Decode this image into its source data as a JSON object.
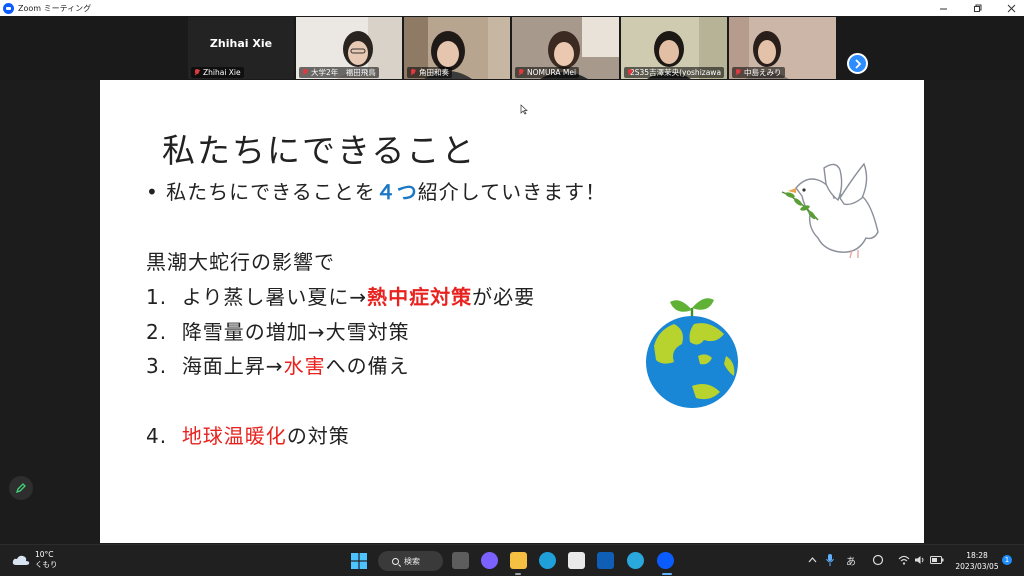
{
  "window": {
    "title": "Zoom ミーティング"
  },
  "participants": [
    {
      "name": "Zhihai Xie",
      "video": false
    },
    {
      "name": "大学2年　福田飛鳥",
      "video": true
    },
    {
      "name": "角田和奏",
      "video": true
    },
    {
      "name": "NOMURA Mei",
      "video": true
    },
    {
      "name": "2S35吉澤茉央(yoshizawa ...",
      "video": true
    },
    {
      "name": "中島えみり",
      "video": true
    }
  ],
  "slide": {
    "title": "私たちにできること",
    "bullet": {
      "pre": "私たちにできることを",
      "highlight": "４つ",
      "post": "紹介していきます！"
    },
    "intro": "黒潮大蛇行の影響で",
    "items": [
      {
        "num": "1.",
        "pre": "より蒸し暑い夏に→",
        "highlight": "熱中症対策",
        "post": "が必要",
        "bold": true
      },
      {
        "num": "2.",
        "pre": "降雪量の増加→大雪対策",
        "highlight": "",
        "post": "",
        "bold": false
      },
      {
        "num": "3.",
        "pre": "海面上昇→",
        "highlight": "水害",
        "post": "への備え",
        "bold": false
      },
      {
        "num": "4.",
        "pre": "",
        "highlight": "地球温暖化",
        "post": "の対策",
        "bold": false
      }
    ]
  },
  "taskbar": {
    "weather": {
      "temp": "10°C",
      "condition": "くもり"
    },
    "search_label": "検索",
    "ime": "あ",
    "clock": {
      "time": "18:28",
      "date": "2023/03/05"
    },
    "notification_count": "1"
  },
  "colors": {
    "accent_blue": "#1b78c6",
    "highlight_red": "#e8231f",
    "zoom_blue": "#0b5cff"
  }
}
